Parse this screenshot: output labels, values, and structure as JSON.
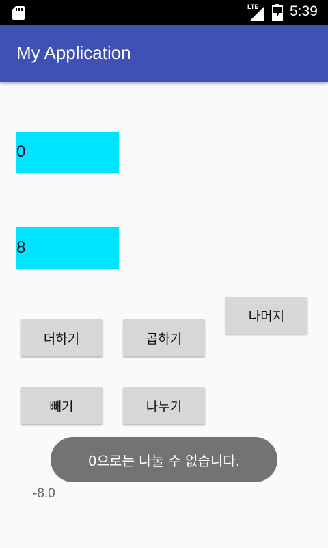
{
  "status_bar": {
    "network": "LTE",
    "time": "5:39"
  },
  "app_bar": {
    "title": "My Application",
    "color": "#3f51b5"
  },
  "inputs": {
    "first_value": "0",
    "second_value": "8",
    "field_color": "#00e5ff"
  },
  "buttons": {
    "add": "더하기",
    "multiply": "곱하기",
    "remainder": "나머지",
    "subtract": "빼기",
    "divide": "나누기"
  },
  "toast": {
    "message": "0으로는 나눌 수 없습니다."
  },
  "result": {
    "value": "-8.0"
  }
}
